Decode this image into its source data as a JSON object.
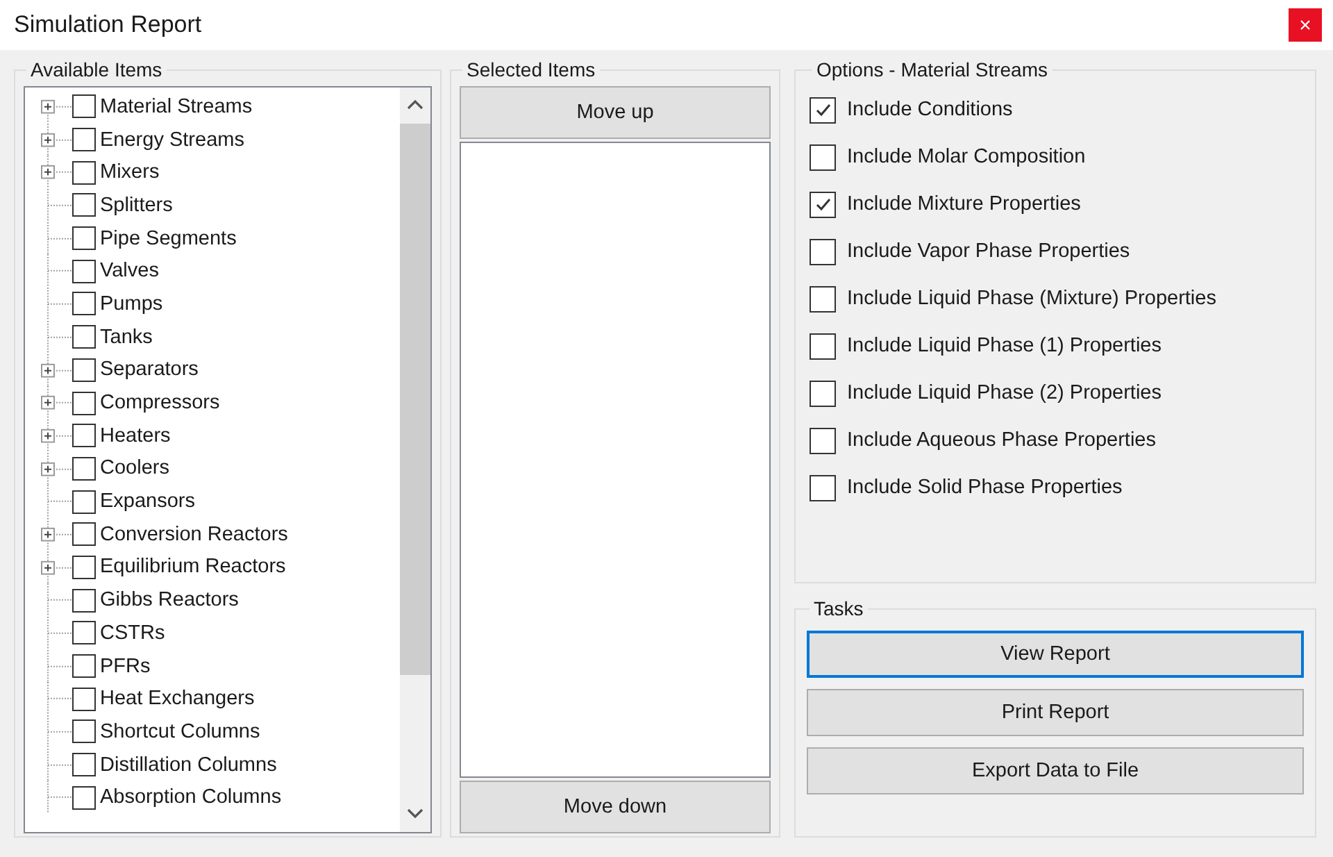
{
  "window": {
    "title": "Simulation Report",
    "close": "×"
  },
  "available_items": {
    "title": "Available Items",
    "items": [
      {
        "label": "Material Streams",
        "expandable": true,
        "checked": false
      },
      {
        "label": "Energy Streams",
        "expandable": true,
        "checked": false
      },
      {
        "label": "Mixers",
        "expandable": true,
        "checked": false
      },
      {
        "label": "Splitters",
        "expandable": false,
        "checked": false
      },
      {
        "label": "Pipe Segments",
        "expandable": false,
        "checked": false
      },
      {
        "label": "Valves",
        "expandable": false,
        "checked": false
      },
      {
        "label": "Pumps",
        "expandable": false,
        "checked": false
      },
      {
        "label": "Tanks",
        "expandable": false,
        "checked": false
      },
      {
        "label": "Separators",
        "expandable": true,
        "checked": false
      },
      {
        "label": "Compressors",
        "expandable": true,
        "checked": false
      },
      {
        "label": "Heaters",
        "expandable": true,
        "checked": false
      },
      {
        "label": "Coolers",
        "expandable": true,
        "checked": false
      },
      {
        "label": "Expansors",
        "expandable": false,
        "checked": false
      },
      {
        "label": "Conversion Reactors",
        "expandable": true,
        "checked": false
      },
      {
        "label": "Equilibrium Reactors",
        "expandable": true,
        "checked": false
      },
      {
        "label": "Gibbs Reactors",
        "expandable": false,
        "checked": false
      },
      {
        "label": "CSTRs",
        "expandable": false,
        "checked": false
      },
      {
        "label": "PFRs",
        "expandable": false,
        "checked": false
      },
      {
        "label": "Heat Exchangers",
        "expandable": false,
        "checked": false
      },
      {
        "label": "Shortcut Columns",
        "expandable": false,
        "checked": false
      },
      {
        "label": "Distillation Columns",
        "expandable": false,
        "checked": false
      },
      {
        "label": "Absorption Columns",
        "expandable": false,
        "checked": false
      }
    ]
  },
  "selected_items": {
    "title": "Selected Items",
    "move_up": "Move up",
    "move_down": "Move down"
  },
  "options": {
    "title": "Options - Material Streams",
    "items": [
      {
        "label": "Include Conditions",
        "checked": true
      },
      {
        "label": "Include Molar Composition",
        "checked": false
      },
      {
        "label": "Include Mixture Properties",
        "checked": true
      },
      {
        "label": "Include Vapor Phase Properties",
        "checked": false
      },
      {
        "label": "Include Liquid Phase (Mixture) Properties",
        "checked": false
      },
      {
        "label": "Include Liquid Phase (1) Properties",
        "checked": false
      },
      {
        "label": "Include Liquid Phase (2) Properties",
        "checked": false
      },
      {
        "label": "Include Aqueous Phase Properties",
        "checked": false
      },
      {
        "label": "Include Solid Phase Properties",
        "checked": false
      }
    ]
  },
  "tasks": {
    "title": "Tasks",
    "buttons": [
      {
        "label": "View Report",
        "focused": true
      },
      {
        "label": "Print Report",
        "focused": false
      },
      {
        "label": "Export Data to File",
        "focused": false
      }
    ]
  }
}
